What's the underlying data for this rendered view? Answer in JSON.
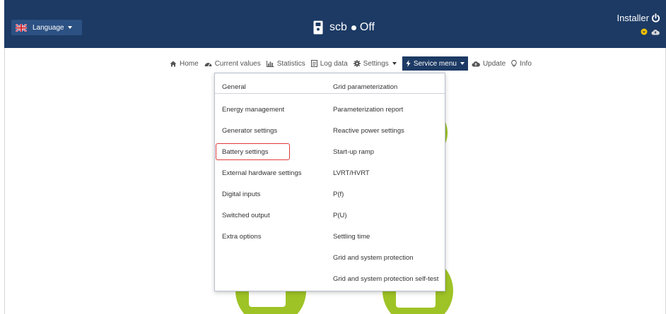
{
  "header": {
    "language_label": "Language",
    "device_name": "scb",
    "device_status": "Off",
    "user_label": "Installer",
    "colors": {
      "header_bg": "#1c3a64",
      "accent_green": "#9ec326",
      "status_yellow": "#f2c200"
    }
  },
  "nav": {
    "items": [
      {
        "label": "Home",
        "icon": "home-icon"
      },
      {
        "label": "Current values",
        "icon": "gauge-icon"
      },
      {
        "label": "Statistics",
        "icon": "bar-chart-icon"
      },
      {
        "label": "Log data",
        "icon": "document-icon"
      },
      {
        "label": "Settings",
        "icon": "gear-icon"
      },
      {
        "label": "Service menu",
        "icon": "lightning-icon",
        "active": true
      },
      {
        "label": "Update",
        "icon": "cloud-upload-icon"
      },
      {
        "label": "Info",
        "icon": "lightbulb-icon"
      }
    ]
  },
  "service_menu": {
    "general": {
      "heading": "General",
      "items": [
        "Energy management",
        "Generator settings",
        "Battery settings",
        "External hardware settings",
        "Digital inputs",
        "Switched output",
        "Extra options"
      ]
    },
    "grid": {
      "heading": "Grid parameterization",
      "items": [
        "Parameterization report",
        "Reactive power settings",
        "Start-up ramp",
        "LVRT/HVRT",
        "P(f)",
        "P(U)",
        "Settling time",
        "Grid and system protection",
        "Grid and system protection self-test"
      ]
    },
    "highlighted_item": "Battery settings"
  }
}
